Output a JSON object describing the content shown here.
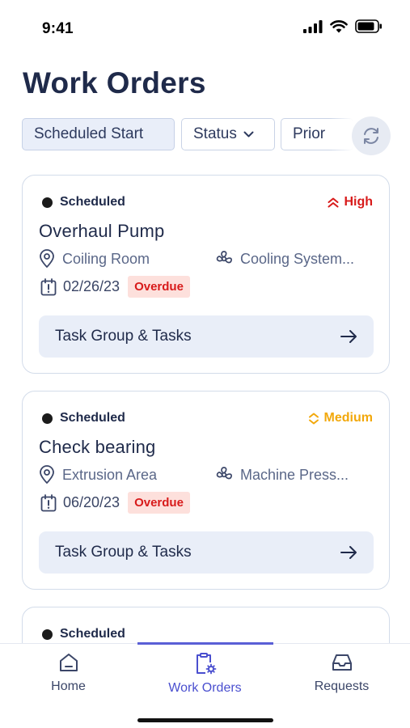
{
  "status_bar": {
    "time": "9:41"
  },
  "page": {
    "title": "Work Orders"
  },
  "filters": [
    {
      "label": "Scheduled Start"
    },
    {
      "label": "Status"
    },
    {
      "label": "Prior"
    }
  ],
  "work_orders": [
    {
      "status": "Scheduled",
      "priority": "High",
      "priority_color": "#d81b1b",
      "title": "Overhaul Pump",
      "location": "Coiling Room",
      "asset": "Cooling System...",
      "date": "02/26/23",
      "badge": "Overdue",
      "action": "Task Group & Tasks"
    },
    {
      "status": "Scheduled",
      "priority": "Medium",
      "priority_color": "#f2a80b",
      "title": "Check bearing",
      "location": "Extrusion Area",
      "asset": "Machine Press...",
      "date": "06/20/23",
      "badge": "Overdue",
      "action": "Task Group & Tasks"
    },
    {
      "status": "Scheduled"
    }
  ],
  "nav": {
    "items": [
      {
        "label": "Home",
        "icon": "home-icon"
      },
      {
        "label": "Work Orders",
        "icon": "clipboard-gear-icon",
        "active": true
      },
      {
        "label": "Requests",
        "icon": "inbox-icon"
      }
    ],
    "active_color": "#4a4fcf"
  }
}
